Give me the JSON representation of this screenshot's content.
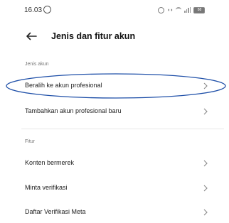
{
  "status_bar": {
    "time": "16.03",
    "battery": "88"
  },
  "header": {
    "title": "Jenis dan fitur akun"
  },
  "sections": {
    "account_type": {
      "label": "Jenis akun",
      "items": [
        {
          "label": "Beralih ke akun profesional"
        },
        {
          "label": "Tambahkan akun profesional baru"
        }
      ]
    },
    "features": {
      "label": "Fitur",
      "items": [
        {
          "label": "Konten bermerek"
        },
        {
          "label": "Minta verifikasi"
        },
        {
          "label": "Daftar Verifikasi Meta"
        }
      ]
    }
  },
  "annotation": {
    "highlight_color": "#1e4fa8"
  },
  "icons": [
    "whatsapp-icon",
    "alarm-icon",
    "vo-icon",
    "wifi-icon",
    "signal-icon",
    "battery-icon",
    "back-arrow-icon",
    "chevron-right-icon"
  ]
}
